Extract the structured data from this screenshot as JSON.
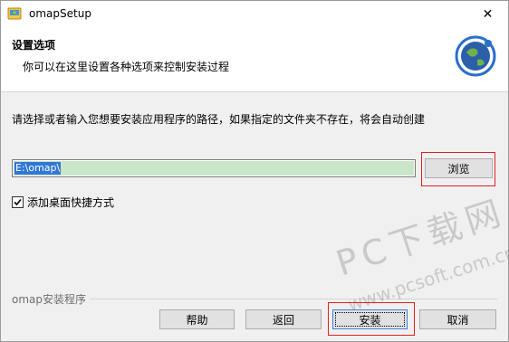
{
  "window": {
    "title": "omapSetup",
    "close_glyph": "✕"
  },
  "header": {
    "title": "设置选项",
    "subtitle": "你可以在这里设置各种选项来控制安装过程"
  },
  "main": {
    "description": "请选择或者输入您想要安装应用程序的路径，如果指定的文件夹不存在，将会自动创建",
    "install_path": "E:\\omap\\",
    "browse_label": "浏览",
    "shortcut_label": "添加桌面快捷方式",
    "shortcut_checked": true
  },
  "footer": {
    "group_label": "omap安装程序",
    "help_label": "帮助",
    "back_label": "返回",
    "install_label": "安装",
    "cancel_label": "取消"
  },
  "watermark": {
    "line1": "PC下载网",
    "line2": "www.pcsoft.com.cn"
  },
  "colors": {
    "highlight_box": "#e02020",
    "path_fill": "#c9e6c9",
    "selection": "#3177d6"
  },
  "icons": {
    "app": "installer-app-icon",
    "globe": "globe-logo-icon",
    "close": "close-icon",
    "check": "checkmark-icon"
  }
}
